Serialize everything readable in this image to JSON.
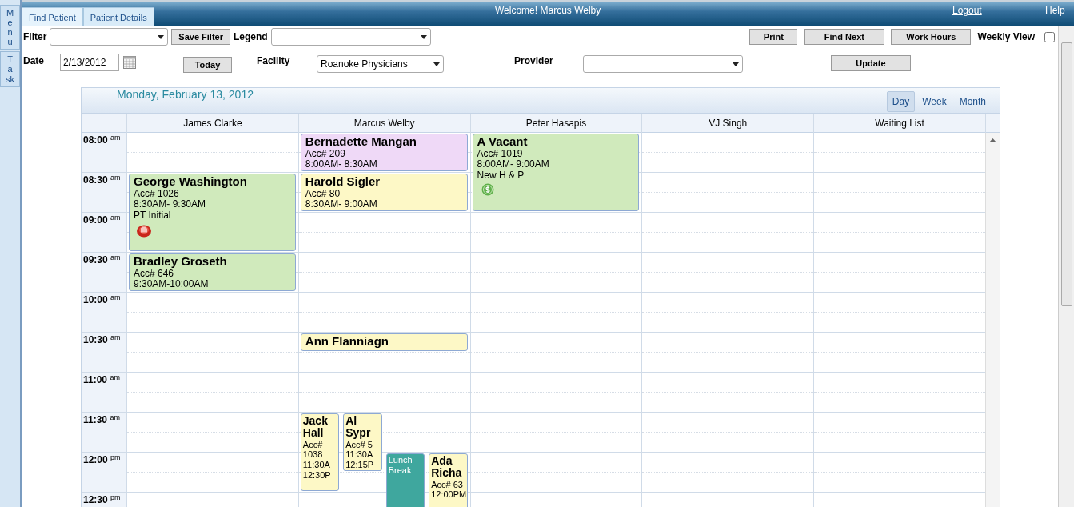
{
  "side_tabs": [
    {
      "label": "Menu"
    },
    {
      "label": "Task"
    }
  ],
  "header": {
    "tabs": [
      {
        "label": "Find Patient",
        "selected": true
      },
      {
        "label": "Patient Details",
        "selected": false
      }
    ],
    "welcome": "Welcome! Marcus Welby",
    "links": [
      "Logout",
      "Help"
    ]
  },
  "toolbar": {
    "filter_label": "Filter",
    "save_filter": "Save Filter",
    "legend_label": "Legend",
    "buttons": [
      "Print",
      "Find Next",
      "Work Hours"
    ],
    "weekly_view": {
      "label": "Weekly View",
      "checked": false
    },
    "date_label": "Date",
    "date": "2/13/2012",
    "today": "Today",
    "facility_label": "Facility",
    "facility": "Roanoke Physicians",
    "provider_label": "Provider",
    "update": "Update"
  },
  "calendar": {
    "title": "Monday, February 13, 2012",
    "views": [
      {
        "label": "Day",
        "selected": true
      },
      {
        "label": "Week",
        "selected": false
      },
      {
        "label": "Month",
        "selected": false
      }
    ],
    "columns": [
      "James Clarke",
      "Marcus Welby",
      "Peter Hasapis",
      "VJ Singh",
      "Waiting List"
    ],
    "rows": [
      {
        "time": "08:00",
        "period": "am",
        "cells": [
          {},
          {
            "appointments": [
              {
                "kind": "half",
                "name": "Bernadette Mangan",
                "account": "Acc# 209",
                "time": "8:00AM- 8:30AM",
                "color": "#efd9f7"
              }
            ]
          },
          {
            "appointments": [
              {
                "kind": "hour",
                "name": "A Vacant",
                "account": "Acc# 1019",
                "time": "8:00AM- 9:00AM",
                "note": "New H & P",
                "billing": true,
                "color": "#d0eabc"
              }
            ]
          },
          {},
          {}
        ]
      },
      {
        "time": "08:30",
        "period": "am",
        "cells": [
          {
            "appointments": [
              {
                "kind": "hour",
                "name": "George Washington",
                "account": "Acc# 1026",
                "time": "8:30AM- 9:30AM",
                "note": "PT Initial",
                "alert": true,
                "color": "#d0eabc"
              }
            ]
          },
          {
            "appointments": [
              {
                "kind": "half",
                "name": "Harold Sigler",
                "account": "Acc# 80",
                "time": "8:30AM- 9:00AM",
                "color": "#fdf8c6"
              }
            ]
          },
          {},
          {},
          {}
        ]
      },
      {
        "time": "09:00",
        "period": "am",
        "cells": [
          {},
          {},
          {},
          {},
          {}
        ]
      },
      {
        "time": "09:30",
        "period": "am",
        "cells": [
          {
            "appointments": [
              {
                "kind": "half",
                "name": "Bradley Groseth",
                "account": "Acc# 646",
                "time": "9:30AM-10:00AM",
                "color": "#d0eabc"
              }
            ]
          },
          {},
          {},
          {},
          {}
        ]
      },
      {
        "time": "10:00",
        "period": "am",
        "cells": [
          {},
          {},
          {},
          {},
          {}
        ]
      },
      {
        "time": "10:30",
        "period": "am",
        "cells": [
          {},
          {
            "appointments": [
              {
                "kind": "quarter",
                "name": "Ann Flanniagn",
                "color": "#fdf8c6"
              }
            ]
          },
          {},
          {},
          {}
        ]
      },
      {
        "time": "11:00",
        "period": "am",
        "cells": [
          {},
          {},
          {},
          {},
          {}
        ]
      },
      {
        "time": "11:30",
        "period": "am",
        "cells": [
          {},
          {
            "appointments": [
              {
                "kind": "hour",
                "name": "Jack Hall",
                "account": "Acc# 1038",
                "time": "11:30A 12:30P",
                "color": "#fdf8c6"
              },
              {
                "kind": "threequarter",
                "name": "Al Sypr",
                "account": "Acc# 5",
                "time": "11:30A 12:15P",
                "color": "#fdf8c6"
              }
            ]
          },
          {},
          {},
          {}
        ]
      },
      {
        "time": "12:00",
        "period": "pm",
        "cells": [
          {},
          {
            "appointments": [
              {
                "kind": "break",
                "name": "Lunch Break",
                "color": "#3fa79e"
              },
              {
                "kind": "hour",
                "name": "Ada Richa",
                "account": "Acc# 63",
                "time": "12:00PM",
                "color": "#fdf8c6"
              }
            ]
          },
          {},
          {},
          {}
        ]
      },
      {
        "time": "12:30",
        "period": "pm",
        "cells": [
          {},
          {},
          {},
          {},
          {}
        ]
      }
    ]
  }
}
